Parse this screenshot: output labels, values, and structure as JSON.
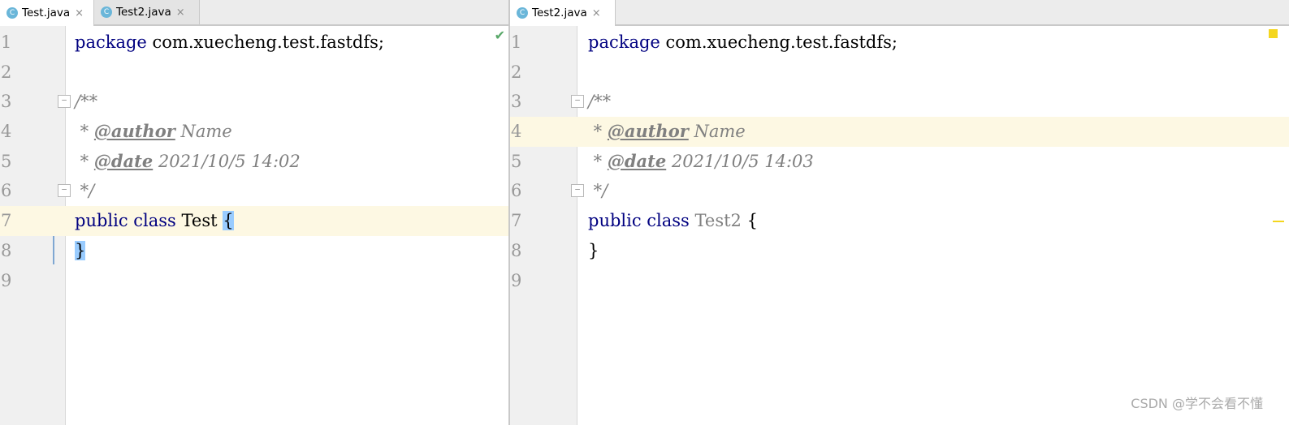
{
  "left_editor": {
    "tabs": [
      {
        "icon": "C",
        "label": "Test.java",
        "close": "×",
        "active": true
      },
      {
        "icon": "C",
        "label": "Test2.java",
        "close": "×",
        "active": false
      }
    ],
    "lines": {
      "l1": {
        "num": "1",
        "kw": "package",
        "rest": " com.xuecheng.test.fastdfs;"
      },
      "l2": {
        "num": "2"
      },
      "l3": {
        "num": "3",
        "text": "/**",
        "fold": "−"
      },
      "l4": {
        "num": "4",
        "prefix": " * ",
        "tag": "@author",
        "rest": " Name"
      },
      "l5": {
        "num": "5",
        "prefix": " * ",
        "tag": "@date",
        "rest": " 2021/10/5 14:02"
      },
      "l6": {
        "num": "6",
        "text": " */",
        "fold": "−"
      },
      "l7": {
        "num": "7",
        "kw": "public class",
        "name": " Test ",
        "brace": "{"
      },
      "l8": {
        "num": "8",
        "brace": "}"
      },
      "l9": {
        "num": "9"
      }
    },
    "status_icon": "check-icon"
  },
  "right_editor": {
    "tabs": [
      {
        "icon": "C",
        "label": "Test2.java",
        "close": "×",
        "active": true
      }
    ],
    "lines": {
      "l1": {
        "num": "1",
        "kw": "package",
        "rest": " com.xuecheng.test.fastdfs;"
      },
      "l2": {
        "num": "2"
      },
      "l3": {
        "num": "3",
        "text": "/**",
        "fold": "−"
      },
      "l4": {
        "num": "4",
        "prefix": " * ",
        "tag": "@author",
        "rest": " Name"
      },
      "l5": {
        "num": "5",
        "prefix": " * ",
        "tag": "@date",
        "rest": " 2021/10/5 14:03"
      },
      "l6": {
        "num": "6",
        "text": " */",
        "fold": "−"
      },
      "l7": {
        "num": "7",
        "kw": "public class",
        "name": " Test2 ",
        "brace": "{"
      },
      "l8": {
        "num": "8",
        "brace": "}"
      },
      "l9": {
        "num": "9"
      }
    },
    "status_icon": "warning-marker"
  },
  "watermark": "CSDN @学不会看不懂",
  "colors": {
    "keyword": "#000080",
    "comment": "#808080",
    "caret_line": "#fdf8e3",
    "brace_highlight": "#99ccff",
    "gutter": "#f0f0f0",
    "tab_icon": "#6ab6d9",
    "warning": "#f4d61e",
    "ok_check": "#59a869"
  }
}
